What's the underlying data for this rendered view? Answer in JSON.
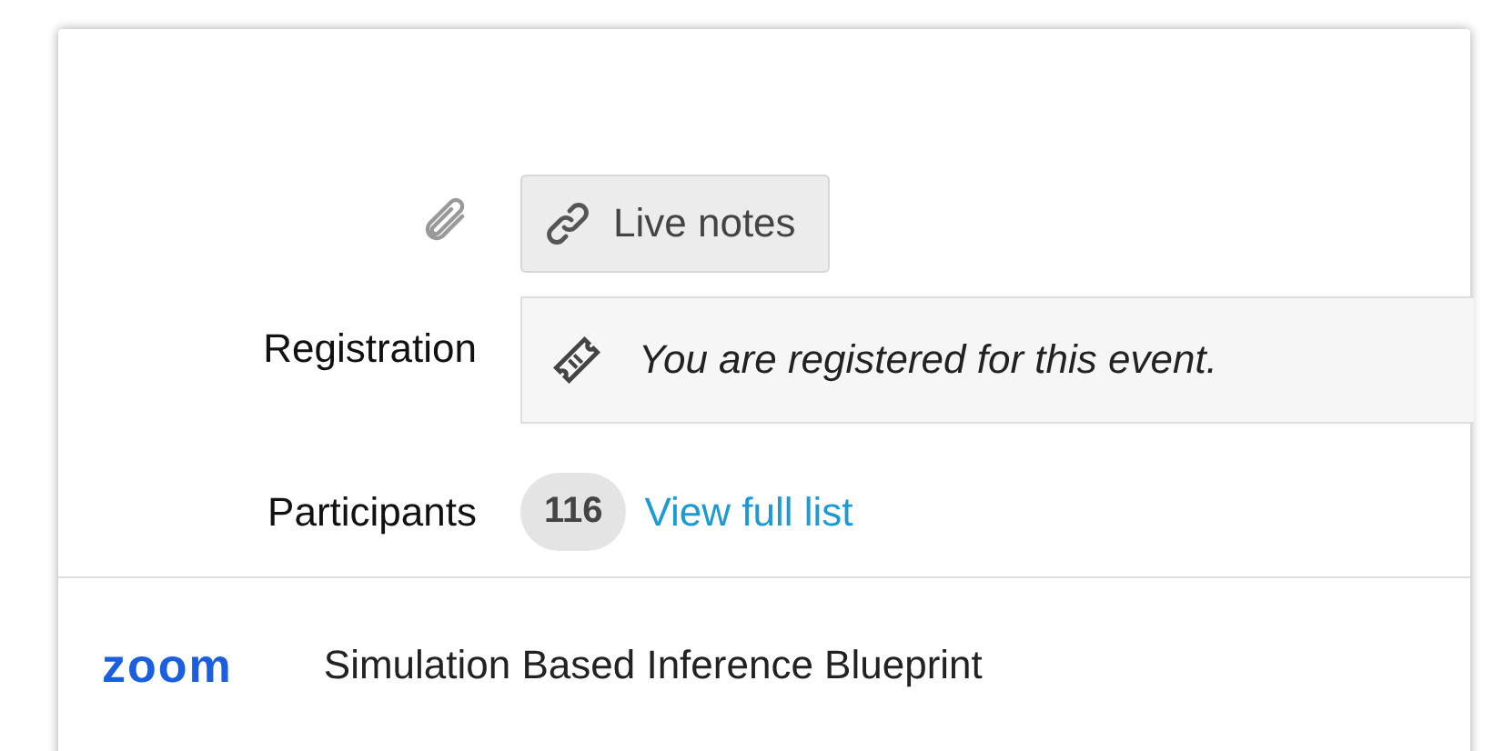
{
  "attachment": {
    "button": "Live notes"
  },
  "registration": {
    "label": "Registration",
    "message": "You are registered for this event."
  },
  "participants": {
    "label": "Participants",
    "count": "116",
    "link": "View full list"
  },
  "meeting": {
    "logo": "zoom",
    "title": "Simulation Based Inference Blueprint"
  }
}
